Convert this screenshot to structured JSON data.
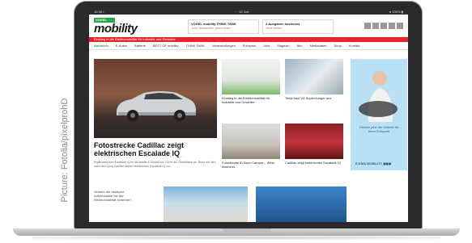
{
  "credit": "Picture: Fotolia/pixelprohD",
  "status": {
    "left": "10:30  ▪",
    "mid": "··· 12 Jun.",
    "right": "● 100% ▮"
  },
  "brand": {
    "tag": "VOGEL",
    "name": "mobility"
  },
  "header": {
    "box1_title": "VOGEL mobility THINK TANK",
    "box1_sub": "Jetzt Newsletter abonnieren",
    "box2_title": "2 Ausgaben kostenlos",
    "box2_sub": "Jetzt testen"
  },
  "banner": "Einstieg in die Elektromobilität für Industrie und Gewerbe",
  "nav": [
    "Aktuelles",
    "E-Autos",
    "Batterie",
    "BEST OF mobility",
    "THINK TANK",
    "Veranstaltungen",
    "Fuhrpark",
    "Jobs",
    "Magazin",
    "Abo",
    "Mediadaten",
    "Shop",
    "Kontakt"
  ],
  "hero": {
    "title": "Fotostrecke Cadillac zeigt elektrischen Escalade IQ",
    "excerpt": "Ergänzend zum Escalade IQ ist die zweite E-Modell von GM in der Oberklasse an. Rund ein Jahr nach dem Lyriq Cadillac seinen elektrischen Escalade IQ vor."
  },
  "tiles": [
    {
      "text": "Einstieg in die Elektromobilität für Industrie und Gewerbe"
    },
    {
      "text": "Tesla baut V4-Supercharger aus"
    },
    {
      "text": "Fotostrecke ID Buzz Camper – Wirtz macht es"
    },
    {
      "text": "Cadillac zeigt elektrischen Escalade IQ"
    }
  ],
  "ad": {
    "text": "Gewinn jetzt die Vorteile für Ihren Fuhrpark",
    "foot": "E-KMA MOBILITY ◼◼◼"
  },
  "bottom_left": "Verkehr die deutsche Autoindustrie bei der Elektromobilität hinterher?"
}
